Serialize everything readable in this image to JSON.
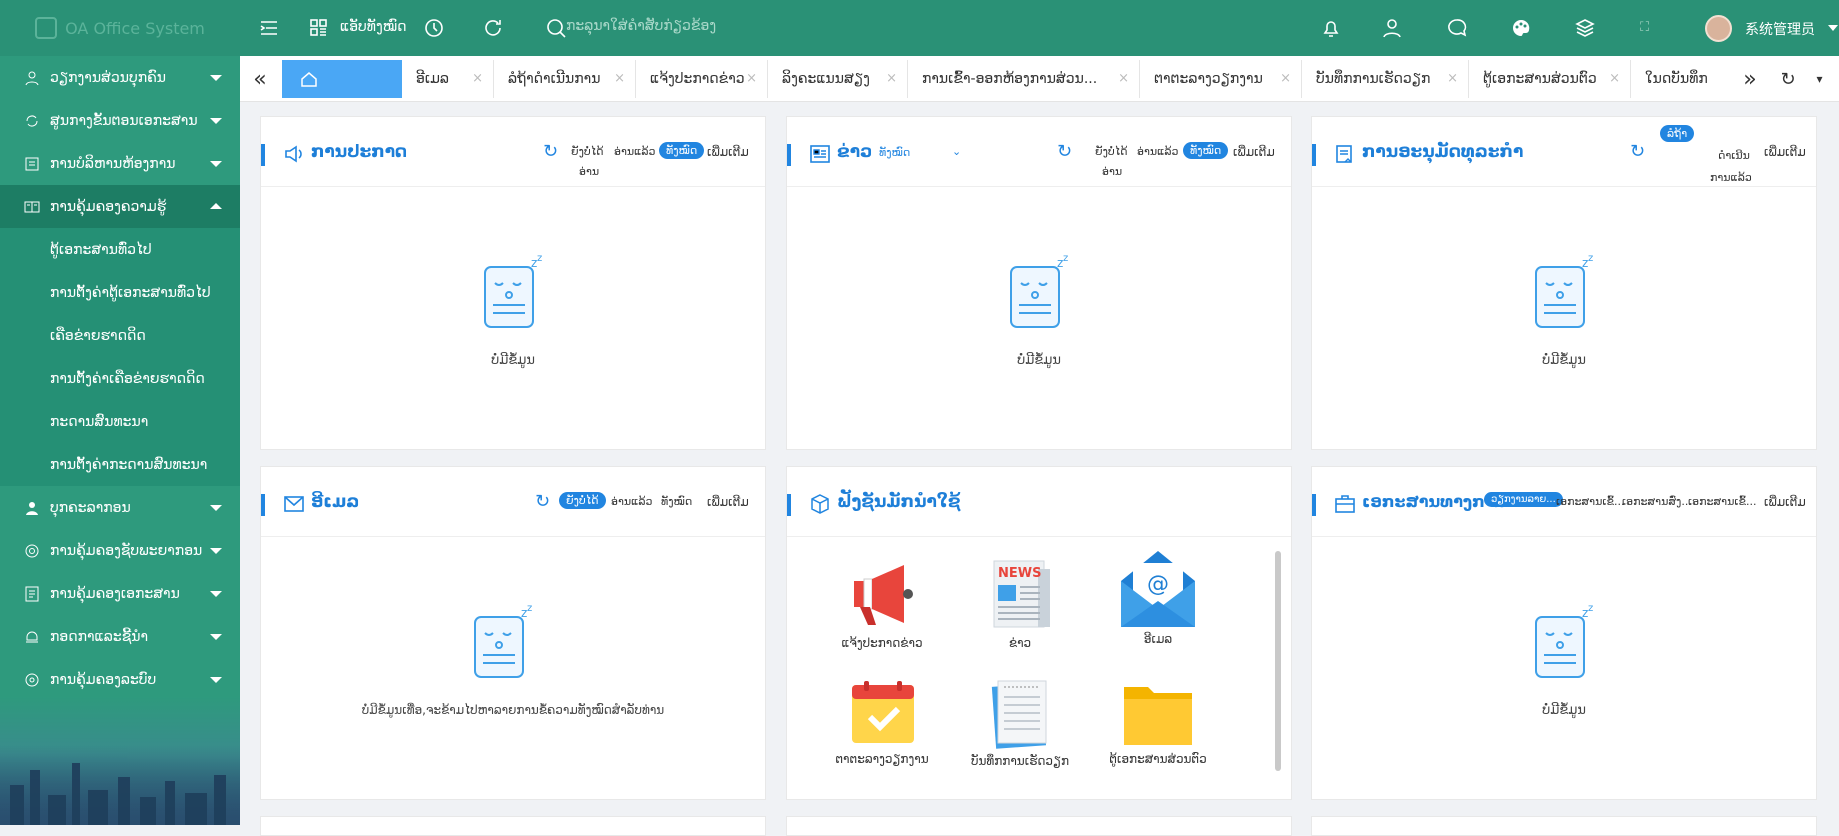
{
  "header": {
    "app_title": "OA Office System",
    "apps_label": "ແອັບທັງໝົດ",
    "search_placeholder": "ກະລຸນາໃສ່ຄໍາສັບກ່ຽວຂ້ອງ",
    "user_name": "系统管理员"
  },
  "sidebar": {
    "items": [
      {
        "label": "ວຽກງານສ່ວນບຸກຄົນ",
        "icon": "user-icon"
      },
      {
        "label": "ສູນກາງຂັ້ນຕອນເອກະສານ",
        "icon": "flow-icon"
      },
      {
        "label": "ການບໍລິຫານຫ້ອງການ",
        "icon": "calendar-icon"
      },
      {
        "label": "ການຄຸ້ມຄອງຄວາມຮູ້",
        "icon": "book-icon"
      },
      {
        "label": "ບຸກຄະລາກອນ",
        "icon": "people-icon"
      },
      {
        "label": "ການຄຸ້ມຄອງຊັບພະຍາກອນ",
        "icon": "target-icon"
      },
      {
        "label": "ການຄຸ້ມຄອງເອກະສານ",
        "icon": "doc-icon"
      },
      {
        "label": "ກອດກາແລະຊີ້ນໍາ",
        "icon": "monitor-icon"
      },
      {
        "label": "ການຄຸ້ມຄອງລະບົບ",
        "icon": "settings-icon"
      }
    ],
    "sub_items": [
      "ຕູ້ເອກະສານທົ່ວໄປ",
      "ການຕັ້ງຄ່າຕູ້ເອກະສານທົ່ວໄປ",
      "ເຄືອຂ່າຍຮາດດິດ",
      "ການຕັ້ງຄ່າເຄືອຂ່າຍຮາດດິດ",
      "ກະດານສົນທະນາ",
      "ການຕັ້ງຄ່າກະດານສົນທະນາ"
    ]
  },
  "tabs": [
    "ອີເມລ",
    "ລໍຖ້າດໍາເນີນການ",
    "ແຈ້ງປະກາດຂ່າວ",
    "ລິງຄະແນນສຽງ",
    "ການເຂົ້າ-ອອກຫ້ອງການສ່ວນ...",
    "ຕາຕະລາງວຽກງານ",
    "ບັນທຶກການເຮັດວຽກ",
    "ຕູ້ເອກະສານສ່ວນຕົວ",
    "ໃນດບັນທຶກ"
  ],
  "cards": {
    "announcement": {
      "title": "ການປະກາດ",
      "unread": "ຍັງບໍ່ໄດ້",
      "unread2": "ອ່ານ",
      "read": "ອ່ານແລ້ວ",
      "all": "ທັງໝົດ",
      "more": "ເພີ່ມເຕີມ",
      "empty": "ບໍ່ມີຂໍ້ມູນ"
    },
    "news": {
      "title": "ຂ່າວ",
      "filter": "ທັງໝົດ",
      "unread": "ຍັງບໍ່ໄດ້",
      "unread2": "ອ່ານ",
      "read": "ອ່ານແລ້ວ",
      "all": "ທັງໝົດ",
      "more": "ເພີ່ມເຕີມ",
      "empty": "ບໍ່ມີຂໍ້ມູນ"
    },
    "approval": {
      "title": "ການອະນຸມັດທຸລະກໍາ",
      "pending": "ລໍຖ້າ",
      "done": "ດໍາເນີນ",
      "done2": "ການແລ້ວ",
      "more": "ເພີ່ມເຕີມ",
      "empty": "ບໍ່ມີຂໍ້ມູນ"
    },
    "email": {
      "title": "ອີເມລ",
      "unread": "ຍັງບໍ່ໄດ້",
      "read": "ອ່ານແລ້ວ",
      "all": "ທັງໝົດ",
      "more": "ເພີ່ມເຕີມ",
      "empty": "ບໍ່ມີຂໍ້ມູນເທື່ອ,ຈະຂ້າມໄປຫາລາຍການຂໍ້ຄວາມທັງໝົດສໍາລັບທ່ານ"
    },
    "shortcuts": {
      "title": "ຟັງຊັນມັກນໍາໃຊ້",
      "items": [
        "ແຈ້ງປະກາດຂ່າວ",
        "ຂ່າວ",
        "ອີເມລ",
        "ຕາຕະລາງວຽກງານ",
        "ບັນທຶກການເຮັດວຽກ",
        "ຕູ້ເອກະສານສ່ວນຕົວ"
      ],
      "news_badge": "NEWS"
    },
    "official_docs": {
      "title": "ເອກະສານທາງການ",
      "tab1": "ວຽກງານລາຍ...",
      "tab2": "ເອກະສານເຂົ້...",
      "tab3": "ເອກະສານສົ່ງ...",
      "tab4": "ເອກະສານເຂົ້...",
      "more": "ເພີ່ມເຕີມ",
      "empty": "ບໍ່ມີຂໍ້ມູນ"
    }
  },
  "colors": {
    "primary": "#2a9176",
    "accent": "#2185e0",
    "active_tab": "#4aa7f5"
  }
}
